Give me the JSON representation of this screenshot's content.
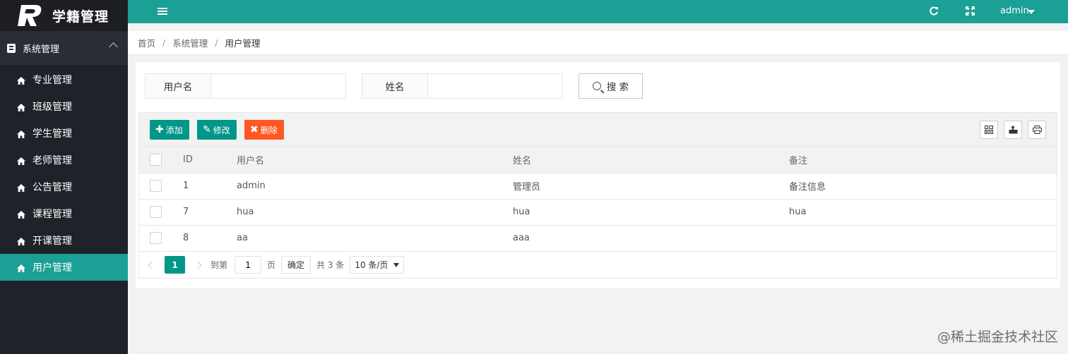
{
  "app": {
    "title": "学籍管理"
  },
  "sidebar": {
    "group_label": "系统管理",
    "items": [
      {
        "label": "专业管理",
        "active": false
      },
      {
        "label": "班级管理",
        "active": false
      },
      {
        "label": "学生管理",
        "active": false
      },
      {
        "label": "老师管理",
        "active": false
      },
      {
        "label": "公告管理",
        "active": false
      },
      {
        "label": "课程管理",
        "active": false
      },
      {
        "label": "开课管理",
        "active": false
      },
      {
        "label": "用户管理",
        "active": true
      }
    ]
  },
  "header": {
    "user": "admin"
  },
  "breadcrumb": {
    "home": "首页",
    "section": "系统管理",
    "current": "用户管理"
  },
  "search": {
    "username_label": "用户名",
    "username_value": "",
    "name_label": "姓名",
    "name_value": "",
    "button_label": "搜 索"
  },
  "toolbar": {
    "add_label": "添加",
    "edit_label": "修改",
    "delete_label": "删除"
  },
  "table": {
    "columns": [
      "ID",
      "用户名",
      "姓名",
      "备注"
    ],
    "rows": [
      {
        "id": "1",
        "username": "admin",
        "name": "管理员",
        "remark": "备注信息"
      },
      {
        "id": "7",
        "username": "hua",
        "name": "hua",
        "remark": "hua"
      },
      {
        "id": "8",
        "username": "aa",
        "name": "aaa",
        "remark": ""
      }
    ]
  },
  "pager": {
    "current_page": "1",
    "goto_label": "到第",
    "goto_value": "1",
    "page_unit": "页",
    "confirm_label": "确定",
    "total_label": "共 3 条",
    "page_size": "10 条/页"
  },
  "watermark": "@稀土掘金技术社区",
  "colors": {
    "primary": "#1aa094",
    "button_green": "#009688",
    "button_red": "#ff5722",
    "sidebar_bg": "#20222a"
  }
}
